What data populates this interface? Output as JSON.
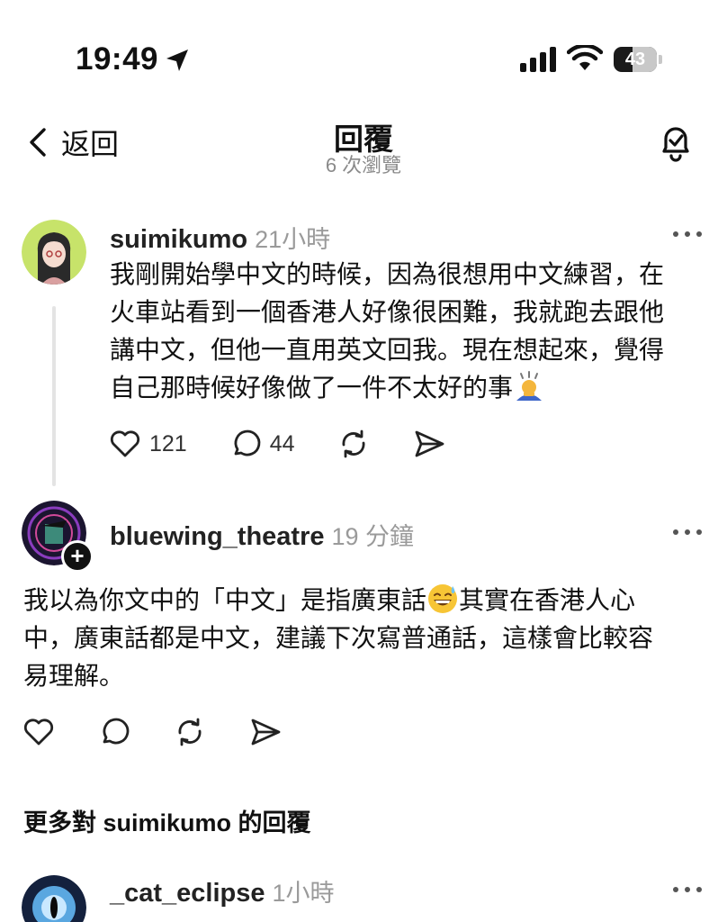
{
  "status": {
    "time": "19:49",
    "battery": "43",
    "battery_level": 0.43,
    "icons": [
      "location-arrow-icon",
      "cellular-signal-icon",
      "wifi-icon",
      "battery-icon"
    ]
  },
  "header": {
    "back_label": "返回",
    "title": "回覆",
    "views": "6 次瀏覽"
  },
  "main_post": {
    "username": "suimikumo",
    "time": "21小時",
    "lines": [
      "我剛開始學中文的時候，因為很想用中文練習，在",
      "火車站看到一個香港人好像很困難，我就跑去跟他",
      "講中文，但他一直用英文回我。現在想起來，覺得",
      "自己那時候好像做了一件不太好的事"
    ],
    "likes": "121",
    "replies": "44"
  },
  "reply_post": {
    "username": "bluewing_theatre",
    "time": "19 分鐘",
    "lines": [
      "我以為你文中的「中文」是指廣東話",
      "其實在香港人心",
      "中，廣東話都是中文，建議下次寫普通話，這樣會比較容",
      "易理解。"
    ]
  },
  "more_section": {
    "title": "更多對 suimikumo 的回覆"
  },
  "next_post": {
    "username": "_cat_eclipse",
    "time": "1小時"
  },
  "colors": {
    "text": "#111111",
    "muted": "#9a9a9a",
    "thread_line": "#e4e4e4"
  }
}
